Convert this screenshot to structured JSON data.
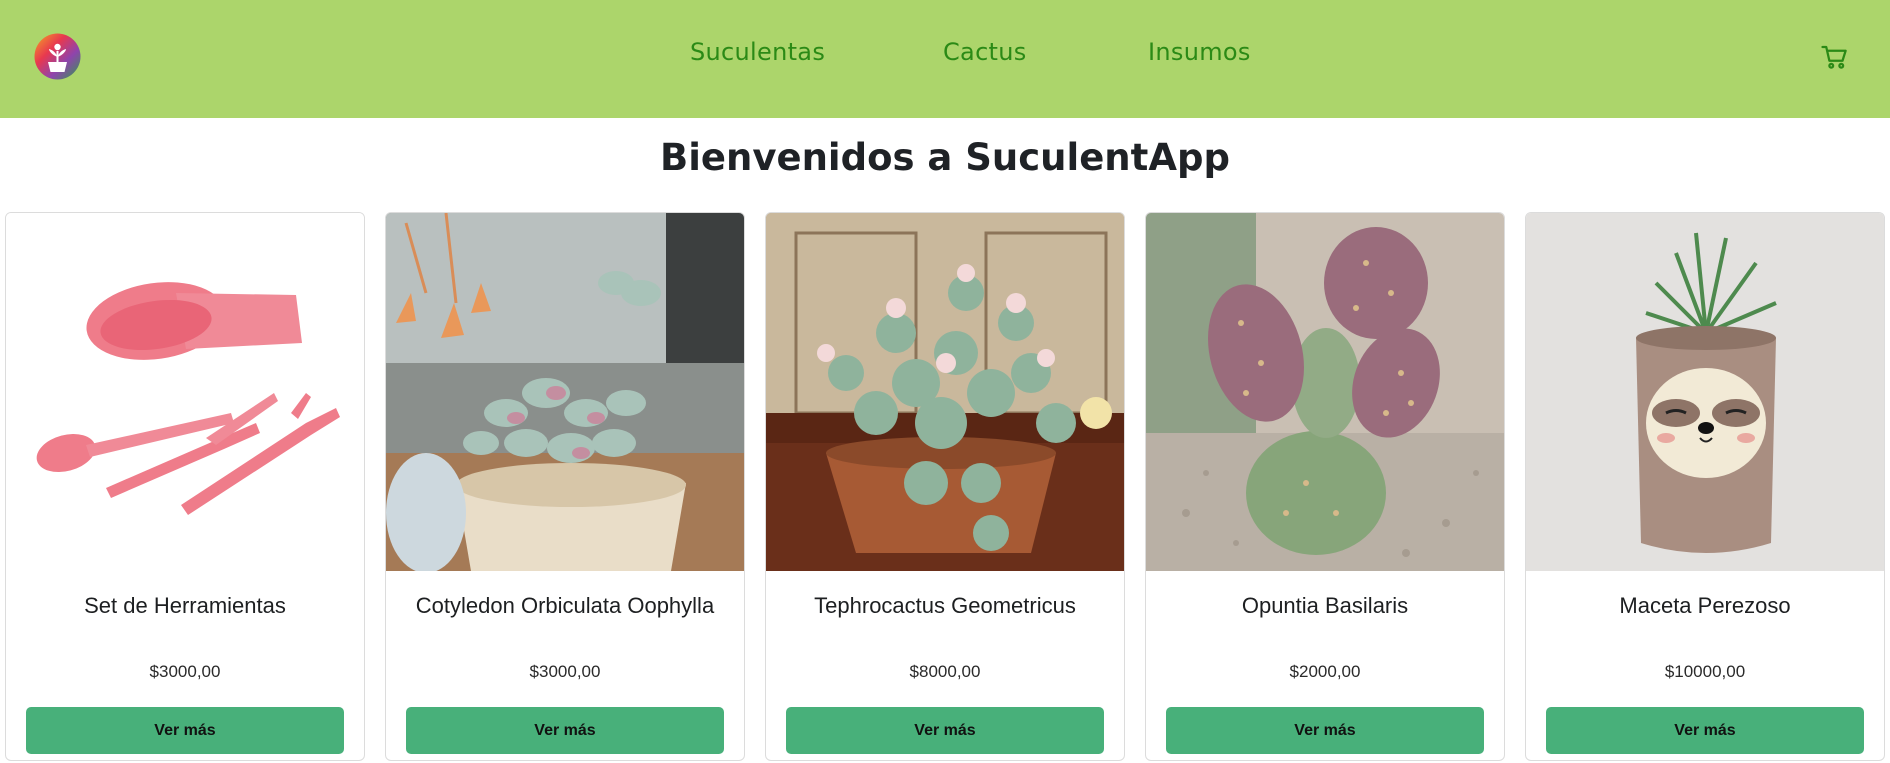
{
  "navbar": {
    "links": [
      {
        "label": "Suculentas"
      },
      {
        "label": "Cactus"
      },
      {
        "label": "Insumos"
      }
    ],
    "logo_icon": "sprout-pot-logo",
    "cart_icon": "shopping-cart-icon",
    "bg_color": "#acd56b",
    "link_color": "#2b8a16"
  },
  "page": {
    "title": "Bienvenidos a SuculentApp"
  },
  "products": [
    {
      "name": "Set de Herramientas",
      "price": "$3000,00",
      "button": "Ver más",
      "image_icon": "garden-tools-image"
    },
    {
      "name": "Cotyledon Orbiculata Oophylla",
      "price": "$3000,00",
      "button": "Ver más",
      "image_icon": "succulent-pot-image"
    },
    {
      "name": "Tephrocactus Geometricus",
      "price": "$8000,00",
      "button": "Ver más",
      "image_icon": "cactus-pot-image"
    },
    {
      "name": "Opuntia Basilaris",
      "price": "$2000,00",
      "button": "Ver más",
      "image_icon": "opuntia-image"
    },
    {
      "name": "Maceta Perezoso",
      "price": "$10000,00",
      "button": "Ver más",
      "image_icon": "sloth-pot-image"
    }
  ],
  "colors": {
    "button": "#48b07a"
  }
}
